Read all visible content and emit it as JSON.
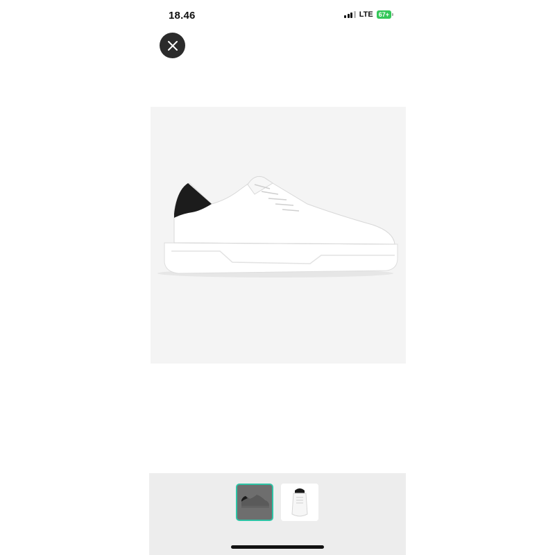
{
  "status_bar": {
    "time": "18.46",
    "network": "LTE",
    "battery": "67+"
  },
  "viewer": {
    "close_icon": "close-icon",
    "image_description_icon": "sneaker-photo"
  },
  "thumbnails": [
    {
      "name": "thumbnail-side-view",
      "selected": true
    },
    {
      "name": "thumbnail-front-view",
      "selected": false
    }
  ],
  "colors": {
    "accent": "#2ec4a6",
    "battery": "#34c759",
    "close_button": "#2b2b2b"
  }
}
